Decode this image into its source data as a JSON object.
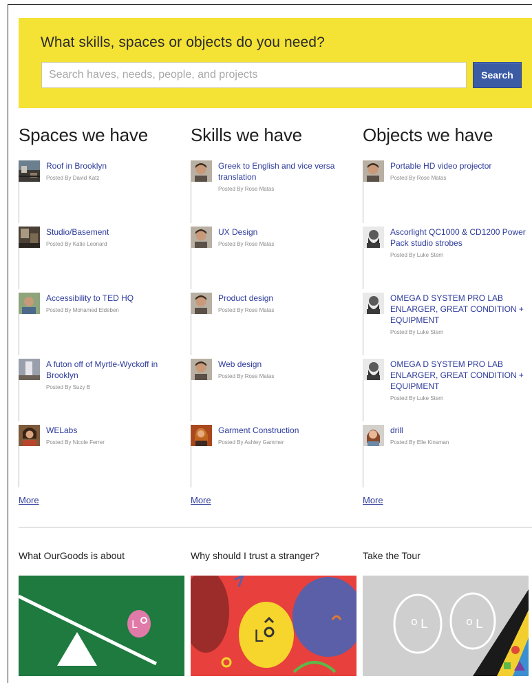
{
  "search": {
    "heading": "What skills, spaces or objects do you need?",
    "placeholder": "Search haves, needs, people, and projects",
    "button_label": "Search",
    "accent_color": "#f4e234",
    "button_color": "#3b5ba5"
  },
  "columns": [
    {
      "title": "Spaces we have",
      "items": [
        {
          "title": "Roof in Brooklyn",
          "meta": "Posted By David Katz",
          "icon": "rooftop-photo"
        },
        {
          "title": "Studio/Basement",
          "meta": "Posted By Katie Leonard",
          "icon": "studio-photo"
        },
        {
          "title": "Accessibility to TED HQ",
          "meta": "Posted By Mohamed Eldeben",
          "icon": "user-avatar"
        },
        {
          "title": "A futon off of Myrtle-Wyckoff in Brooklyn",
          "meta": "Posted By Suzy B",
          "icon": "futon-photo"
        },
        {
          "title": "WELabs",
          "meta": "Posted By Nicole Ferrer",
          "icon": "user-avatar"
        }
      ],
      "more_label": "More"
    },
    {
      "title": "Skills we have",
      "items": [
        {
          "title": "Greek to English and vice versa translation",
          "meta": "Posted By Rose Matas",
          "icon": "user-avatar"
        },
        {
          "title": "UX Design",
          "meta": "Posted By Rose Matas",
          "icon": "user-avatar"
        },
        {
          "title": "Product design",
          "meta": "Posted By Rose Matas",
          "icon": "user-avatar"
        },
        {
          "title": "Web design",
          "meta": "Posted By Rose Matas",
          "icon": "user-avatar"
        },
        {
          "title": "Garment Construction",
          "meta": "Posted By Ashley Gammer",
          "icon": "user-avatar"
        }
      ],
      "more_label": "More"
    },
    {
      "title": "Objects we have",
      "items": [
        {
          "title": "Portable HD video projector",
          "meta": "Posted By Rose Matas",
          "icon": "user-avatar"
        },
        {
          "title": "Ascorlight QC1000 & CD1200 Power Pack studio strobes",
          "meta": "Posted By Luke Stern",
          "icon": "user-avatar"
        },
        {
          "title": "OMEGA D SYSTEM PRO LAB ENLARGER, GREAT CONDITION + EQUIPMENT",
          "meta": "Posted By Luke Stern",
          "icon": "user-avatar"
        },
        {
          "title": "OMEGA D SYSTEM PRO LAB ENLARGER, GREAT CONDITION + EQUIPMENT",
          "meta": "Posted By Luke Stern",
          "icon": "user-avatar"
        },
        {
          "title": "drill",
          "meta": "Posted By Elle Kinsman",
          "icon": "user-avatar"
        }
      ],
      "more_label": "More"
    }
  ],
  "promos": [
    {
      "title": "What OurGoods is about",
      "icon": "seesaw-illustration",
      "color": "#1e7a3f"
    },
    {
      "title": "Why should I trust a stranger?",
      "icon": "faces-illustration",
      "color": "#e8403c"
    },
    {
      "title": "Take the Tour",
      "icon": "tour-illustration",
      "color": "#cfcfcf"
    }
  ]
}
